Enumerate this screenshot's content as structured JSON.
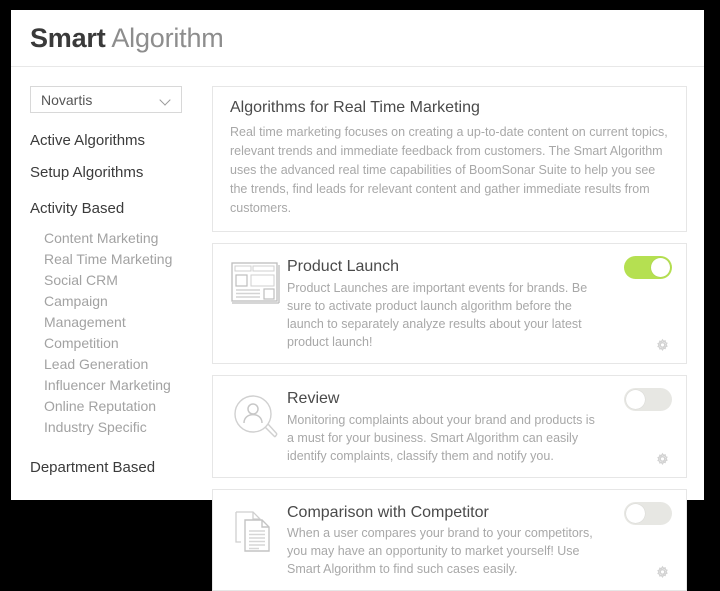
{
  "header": {
    "title_strong": "Smart",
    "title_light": " Algorithm"
  },
  "sidebar": {
    "brand_select": {
      "value": "Novartis",
      "icon": "chevron-down-icon"
    },
    "top_items": [
      {
        "label": "Active Algorithms"
      },
      {
        "label": "Setup Algorithms"
      }
    ],
    "groups": [
      {
        "label": "Activity Based",
        "items": [
          {
            "label": "Content Marketing"
          },
          {
            "label": "Real Time Marketing"
          },
          {
            "label": "Social CRM"
          },
          {
            "label": "Campaign"
          },
          {
            "label": "Management"
          },
          {
            "label": "Competition"
          },
          {
            "label": "Lead Generation"
          },
          {
            "label": "Influencer Marketing"
          },
          {
            "label": "Online Reputation"
          },
          {
            "label": "Industry Specific"
          }
        ]
      },
      {
        "label": "Department Based",
        "items": []
      }
    ]
  },
  "main": {
    "intro": {
      "title": "Algorithms for Real Time Marketing",
      "text": "Real time marketing focuses on creating a up-to-date content on current topics, relevant trends and immediate feedback from customers. The Smart Algorithm uses the advanced real time capabilities of BoomSonar Suite to help you see the trends, find leads for relevant content and gather immediate results from customers."
    },
    "algorithms": [
      {
        "title": "Product Launch",
        "text": "Product Launches are important events for brands. Be sure to activate product launch algorithm before the launch to separately analyze results about your latest product launch!",
        "icon": "webpage-layout-icon",
        "enabled": true,
        "toggle_state": "on",
        "settings_icon": "gear-icon"
      },
      {
        "title": "Review",
        "text": "Monitoring complaints about your brand and products is a must for your business. Smart Algorithm can easily identify complaints, classify them and notify you.",
        "icon": "person-search-icon",
        "enabled": false,
        "toggle_state": "off",
        "settings_icon": "gear-icon"
      },
      {
        "title": "Comparison with Competitor",
        "text": "When a user compares your brand to your competitors, you may have an opportunity to market yourself! Use Smart Algorithm to find such cases easily.",
        "icon": "documents-compare-icon",
        "enabled": false,
        "toggle_state": "off",
        "settings_icon": "gear-icon"
      }
    ]
  },
  "colors": {
    "toggle_on": "#b5e051",
    "toggle_off": "#e7e7e3",
    "title_dark": "#3a3a3a",
    "text_muted": "#a8a8a8",
    "page_background": "#000000"
  }
}
